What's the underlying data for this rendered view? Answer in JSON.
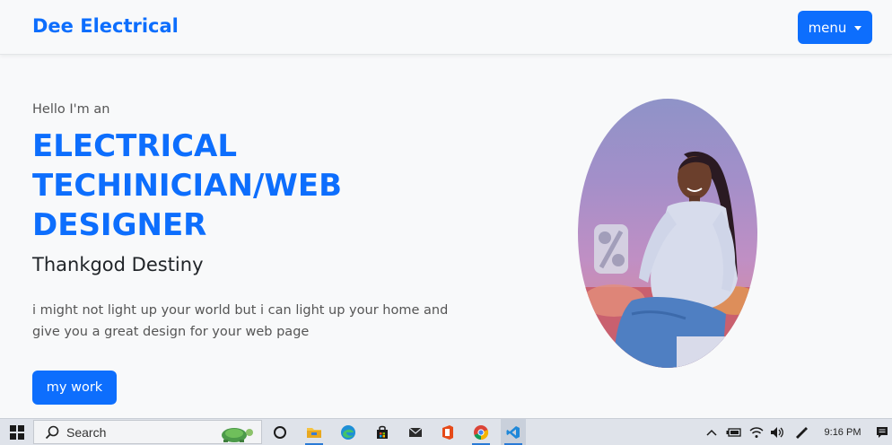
{
  "navbar": {
    "brand": "Dee Electrical",
    "menu_label": "menu"
  },
  "hero": {
    "greeting": "Hello I'm an",
    "headline_lines": [
      "ELECTRICAL",
      "TECHINICIAN/WEB",
      "DESIGNER"
    ],
    "name": "Thankgod Destiny",
    "tagline": "i might not light up your world but i can light up your home and give you a great design for your web page",
    "cta_label": "my work"
  },
  "taskbar": {
    "search_label": "Search",
    "pinned_apps": [
      "task-view",
      "file-explorer",
      "edge",
      "microsoft-store",
      "mail",
      "office",
      "chrome",
      "vscode"
    ],
    "time": "9:16 PM"
  },
  "colors": {
    "accent": "#0d6efd",
    "page_bg": "#f8f9fa",
    "taskbar_bg": "#dfe3ea"
  }
}
